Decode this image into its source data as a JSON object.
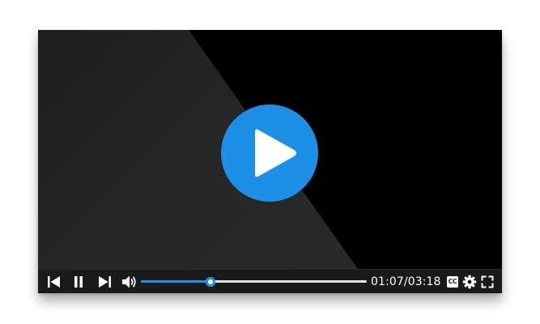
{
  "player": {
    "accent_color": "#1e8fe6",
    "big_play_icon": "play-icon",
    "controls": {
      "previous_icon": "skip-previous-icon",
      "pause_icon": "pause-icon",
      "next_icon": "skip-next-icon",
      "volume_icon": "volume-icon",
      "settings_icon": "gear-icon",
      "fullscreen_icon": "fullscreen-icon"
    },
    "captions_label": "CC",
    "progress": {
      "played_fraction": 0.309
    },
    "time": {
      "current": "01:07",
      "separator": "/",
      "duration": "03:18"
    }
  }
}
